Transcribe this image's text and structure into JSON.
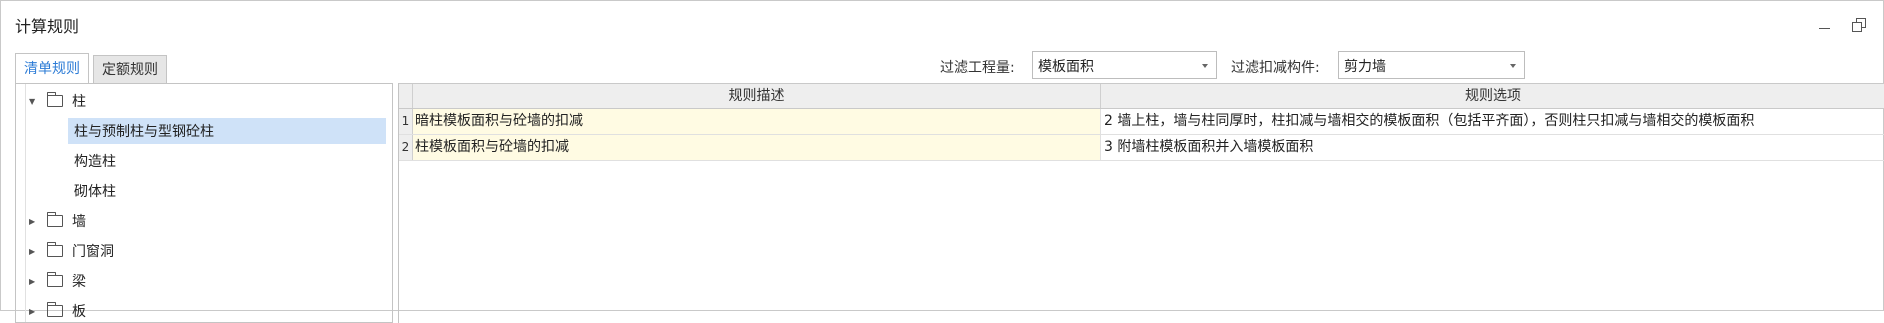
{
  "window": {
    "title": "计算规则"
  },
  "tabs": [
    {
      "label": "清单规则",
      "active": true
    },
    {
      "label": "定额规则",
      "active": false
    }
  ],
  "filters": {
    "quantity_label": "过滤工程量:",
    "quantity_value": "模板面积",
    "component_label": "过滤扣减构件:",
    "component_value": "剪力墙"
  },
  "tree": {
    "group_column": {
      "label": "柱",
      "expanded": true
    },
    "children": [
      "柱与预制柱与型钢砼柱",
      "构造柱",
      "砌体柱"
    ],
    "selected": "柱与预制柱与型钢砼柱",
    "groups_collapsed": [
      "墙",
      "门窗洞",
      "梁",
      "板"
    ]
  },
  "grid": {
    "headers": {
      "description": "规则描述",
      "option": "规则选项"
    },
    "rows": [
      {
        "num": "1",
        "description": "暗柱模板面积与砼墙的扣减",
        "option": "2 墙上柱，墙与柱同厚时，柱扣减与墙相交的模板面积（包括平齐面），否则柱只扣减与墙相交的模板面积"
      },
      {
        "num": "2",
        "description": "柱模板面积与砼墙的扣减",
        "option": "3 附墙柱模板面积并入墙模板面积"
      }
    ]
  }
}
